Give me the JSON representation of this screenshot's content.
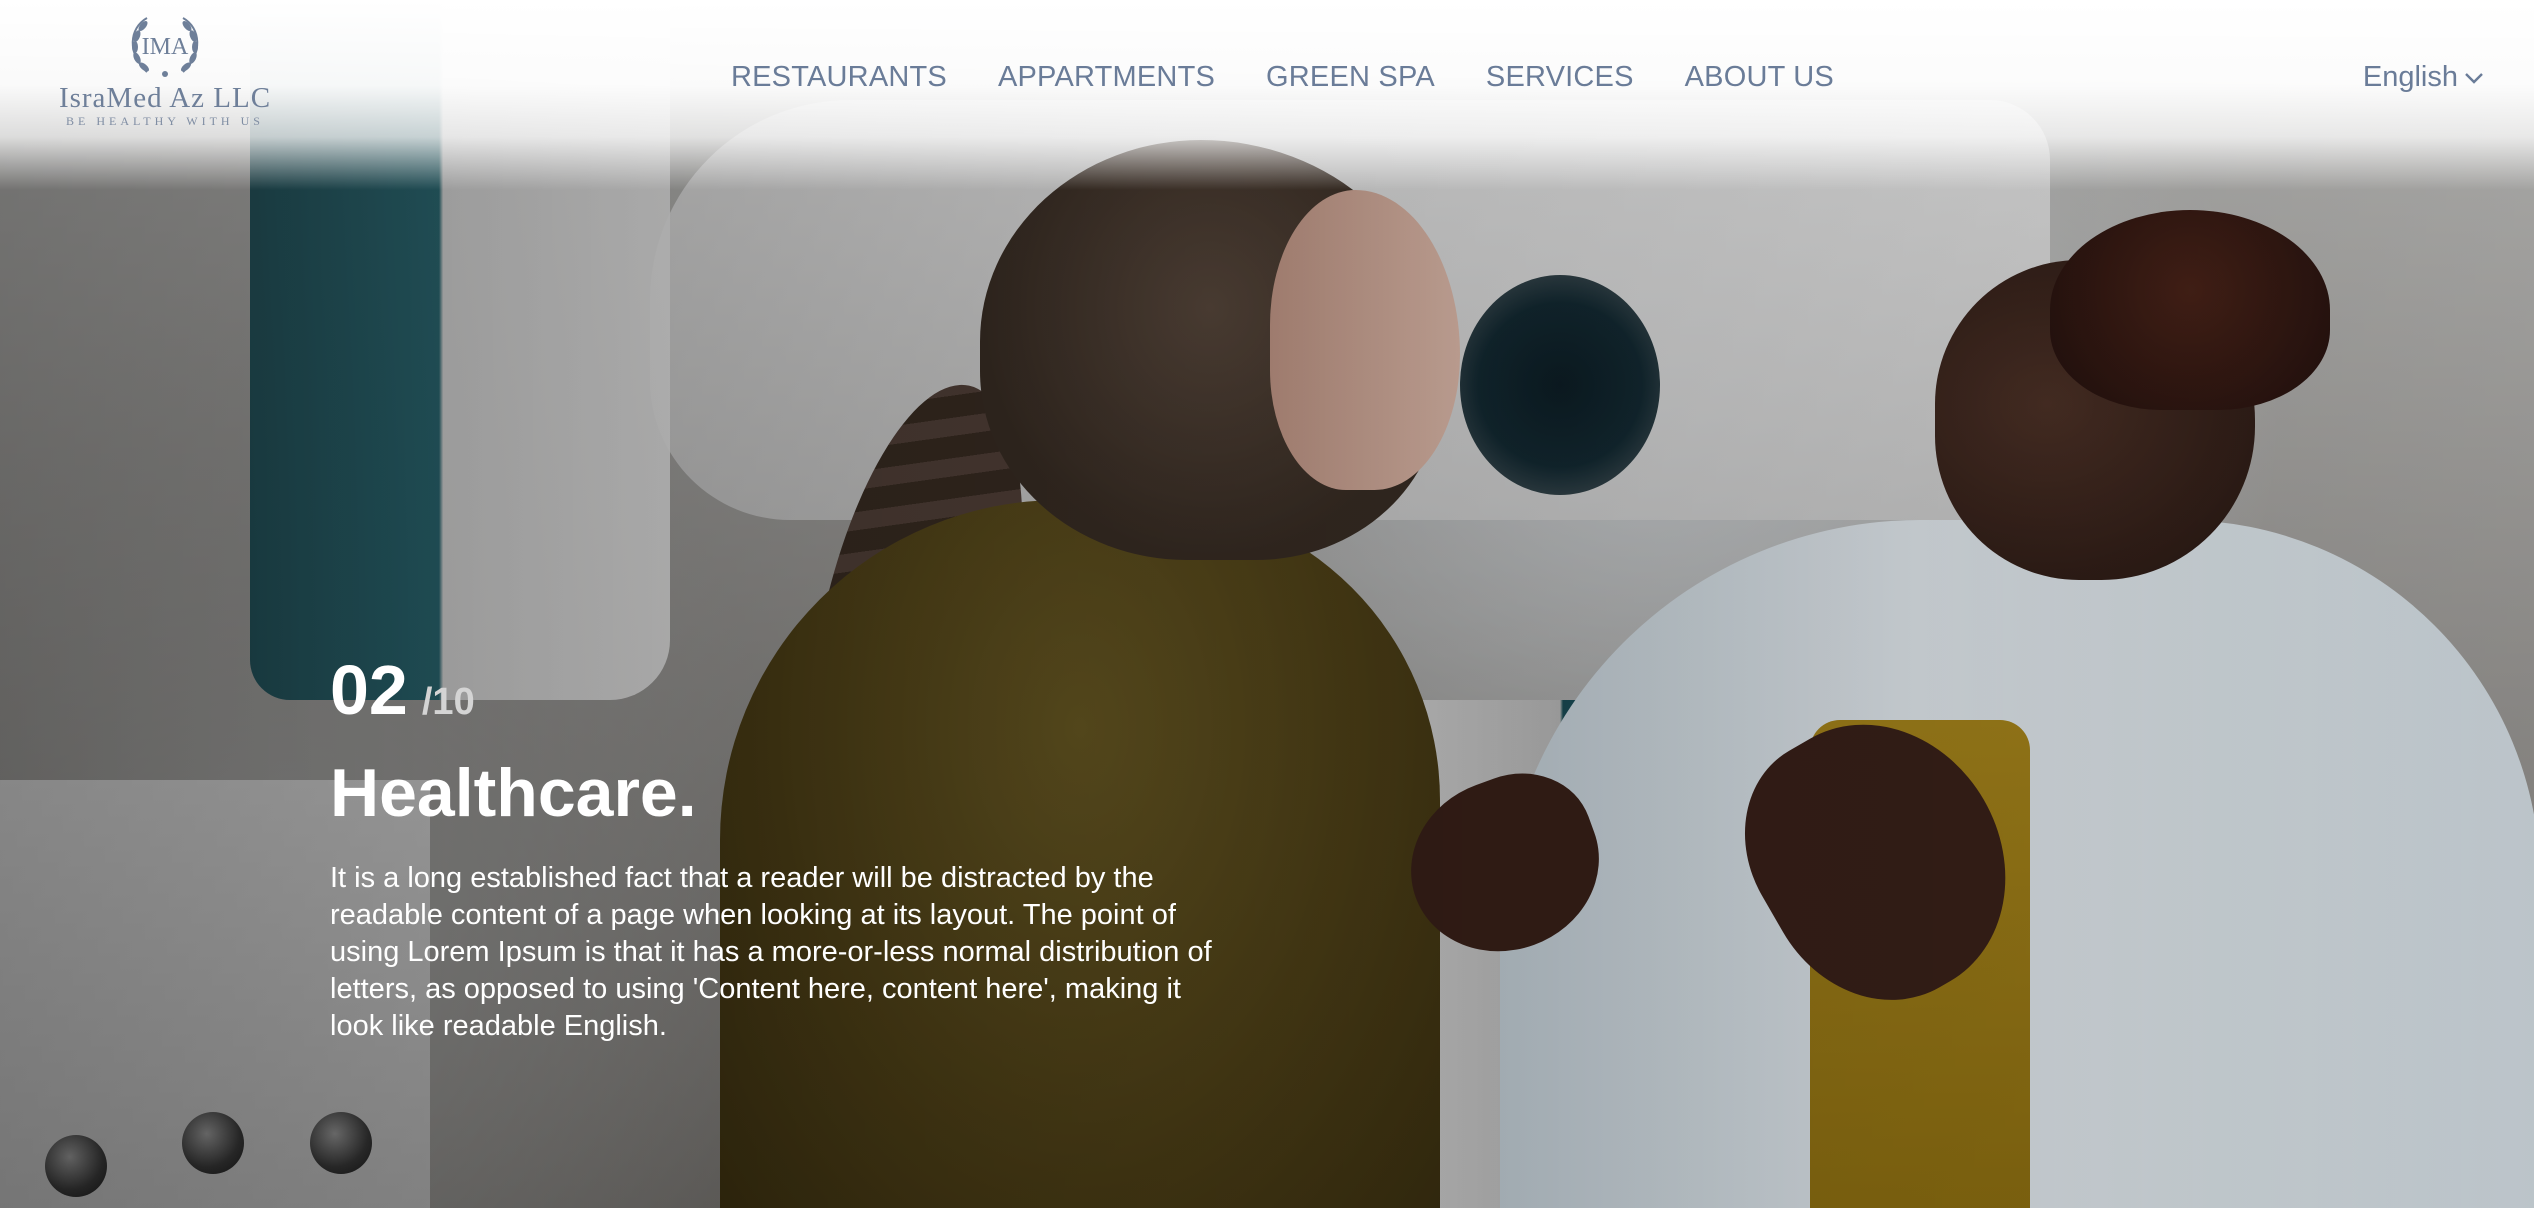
{
  "logo": {
    "monogram": "IMA",
    "name": "IsraMed Az LLC",
    "tagline": "BE HEALTHY WITH US"
  },
  "nav": {
    "items": [
      {
        "label": "RESTAURANTS"
      },
      {
        "label": "APPARTMENTS"
      },
      {
        "label": "GREEN SPA"
      },
      {
        "label": "SERVICES"
      },
      {
        "label": "ABOUT US"
      }
    ]
  },
  "language": {
    "selected": "English",
    "icon": "chevron-down-icon"
  },
  "slide": {
    "current": "02",
    "total": "/10",
    "title": "Healthcare.",
    "body": "It is a long established fact that a reader will be distracted by the readable content of a page when looking at its layout. The point of using Lorem Ipsum is that it has a more-or-less normal distribution of letters, as opposed to using 'Content here, content here', making it look like readable English."
  },
  "colors": {
    "nav_text": "#6a7c98",
    "logo": "#6e7f99",
    "slide_text": "#ffffff",
    "counter_total": "#d4d4d4"
  }
}
